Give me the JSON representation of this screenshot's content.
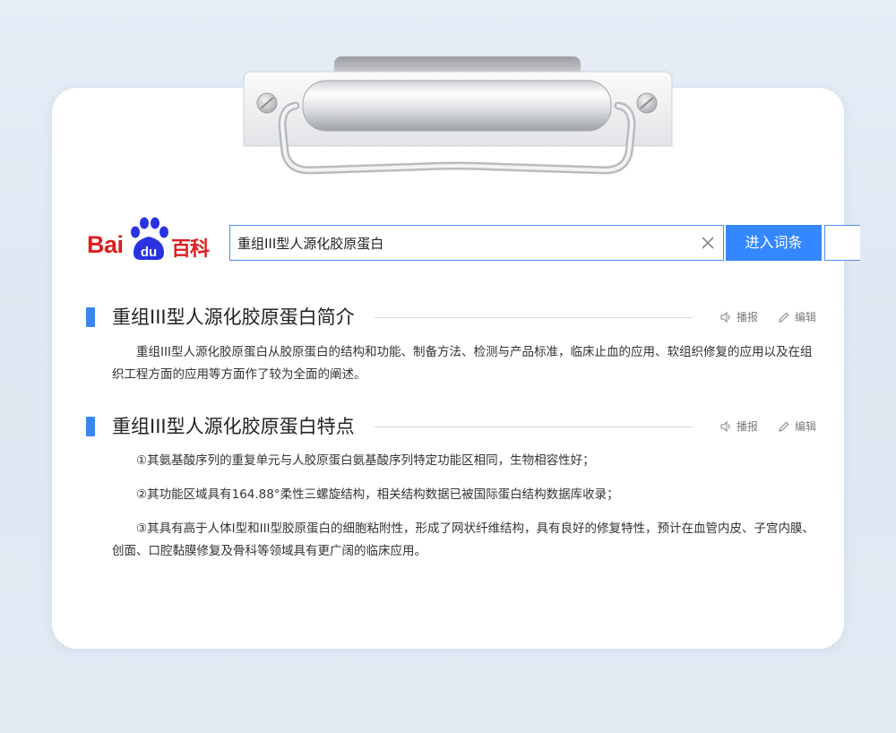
{
  "search": {
    "logo_bai": "Bai",
    "logo_du": "du",
    "logo_suffix": "百科",
    "query": "重组III型人源化胶原蛋白",
    "enter_label": "进入词条"
  },
  "sections": [
    {
      "title": "重组III型人源化胶原蛋白简介",
      "tools": {
        "play": "播报",
        "edit": "编辑"
      },
      "paragraphs": [
        "重组III型人源化胶原蛋白从胶原蛋白的结构和功能、制备方法、检测与产品标准，临床止血的应用、软组织修复的应用以及在组织工程方面的应用等方面作了较为全面的阐述。"
      ]
    },
    {
      "title": "重组III型人源化胶原蛋白特点",
      "tools": {
        "play": "播报",
        "edit": "编辑"
      },
      "paragraphs": [
        "①其氨基酸序列的重复单元与人胶原蛋白氨基酸序列特定功能区相同，生物相容性好；",
        "②其功能区域具有164.88°柔性三螺旋结构，相关结构数据已被国际蛋白结构数据库收录；",
        "③其具有高于人体I型和III型胶原蛋白的细胞粘附性，形成了网状纤维结构，具有良好的修复特性，预计在血管内皮、子宫内膜、创面、口腔黏膜修复及骨科等领域具有更广阔的临床应用。"
      ]
    }
  ],
  "colors": {
    "accent": "#3388ff",
    "logo_red": "#de1e1e",
    "logo_blue": "#2932e1"
  }
}
